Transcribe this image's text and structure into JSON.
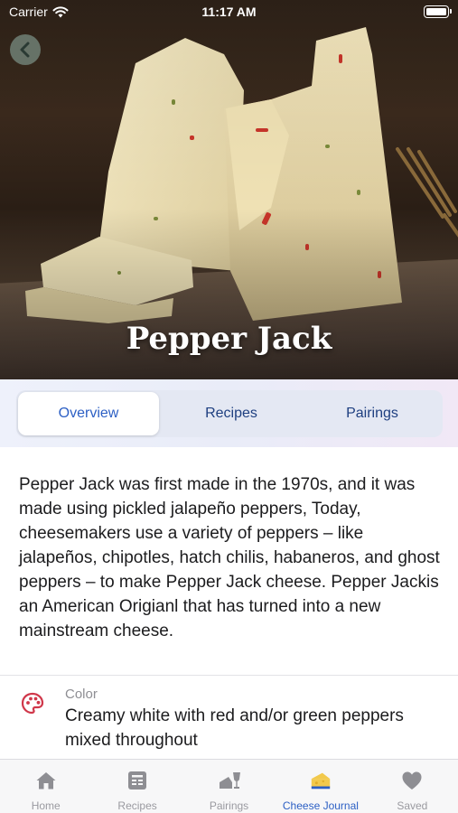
{
  "status_bar": {
    "carrier": "Carrier",
    "time": "11:17 AM"
  },
  "hero": {
    "title": "Pepper Jack"
  },
  "tabs": [
    {
      "label": "Overview",
      "active": true
    },
    {
      "label": "Recipes",
      "active": false
    },
    {
      "label": "Pairings",
      "active": false
    }
  ],
  "overview": {
    "description": "Pepper Jack was first made in the 1970s, and it was made using pickled jalapeño peppers, Today, cheesemakers use a variety of peppers – like jalapeños, chipotles, hatch chilis, habaneros, and ghost peppers – to make Pepper Jack cheese. Pepper Jackis an American Origianl that has turned into a new mainstream cheese.",
    "properties": [
      {
        "icon": "palette-icon",
        "label": "Color",
        "value": "Creamy white with red and/or green peppers mixed throughout"
      }
    ]
  },
  "tab_bar": [
    {
      "label": "Home",
      "icon": "house-icon",
      "active": false
    },
    {
      "label": "Recipes",
      "icon": "recipe-card-icon",
      "active": false
    },
    {
      "label": "Pairings",
      "icon": "cheese-wine-icon",
      "active": false
    },
    {
      "label": "Cheese Journal",
      "icon": "cheese-journal-icon",
      "active": true
    },
    {
      "label": "Saved",
      "icon": "heart-icon",
      "active": false
    }
  ],
  "colors": {
    "accent": "#2c5fc4",
    "tab_text": "#1e3f80",
    "inactive": "#9a9aa0",
    "palette_red": "#d0374a",
    "journal_yellow": "#f2c94c"
  }
}
